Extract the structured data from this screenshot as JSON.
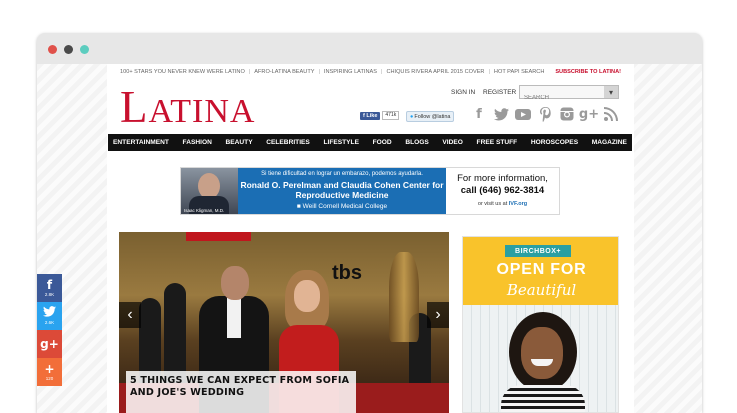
{
  "topbar": {
    "links": [
      "100+ STARS YOU NEVER KNEW WERE LATINO",
      "AFRO-LATINA BEAUTY",
      "INSPIRING LATINAS",
      "CHIQUIS RIVERA APRIL 2015 COVER",
      "HOT PAPI SEARCH"
    ],
    "subscribe": "SUBSCRIBE TO LATINA!"
  },
  "header": {
    "logo_first": "L",
    "logo_rest": "ATINA",
    "signin": "SIGN IN",
    "register": "REGISTER",
    "search_placeholder": "SEARCH",
    "fb_like": "Like",
    "fb_count": "471k",
    "tw_follow": "Follow @latina"
  },
  "social_icons": [
    "facebook-icon",
    "twitter-icon",
    "youtube-icon",
    "pinterest-icon",
    "instagram-icon",
    "google-plus-icon",
    "rss-icon"
  ],
  "nav": [
    "ENTERTAINMENT",
    "FASHION",
    "BEAUTY",
    "CELEBRITIES",
    "LIFESTYLE",
    "FOOD",
    "BLOGS",
    "VIDEO",
    "FREE STUFF",
    "HOROSCOPES",
    "MAGAZINE"
  ],
  "banner": {
    "photo_caption": "Isaac Kligman, M.D.",
    "spanish": "Si tiene dificultad en lograr un embarazo, podemos ayudarla.",
    "center": "Ronald O. Perelman and Claudia Cohen Center for Reproductive Medicine",
    "college": "Weill Cornell Medical College",
    "more_info": "For more information,",
    "phone": "call (646) 962-3814",
    "visit_prefix": "or visit us at",
    "visit_site": "IVF.org"
  },
  "hero": {
    "backdrop_logo": "tbs",
    "caption": "5 THINGS WE CAN EXPECT FROM SOFIA AND JOE'S WEDDING",
    "prev": "‹",
    "next": "›"
  },
  "ad": {
    "brand": "BIRCHBOX+",
    "headline": "OPEN FOR",
    "script": "Beautiful"
  },
  "share": [
    {
      "icon": "f",
      "count": "2.8K"
    },
    {
      "icon": "t",
      "count": "2.6K"
    },
    {
      "icon": "g+",
      "count": ""
    },
    {
      "icon": "+",
      "count": "120"
    }
  ],
  "colors": {
    "brand_red": "#c8102e",
    "nav_bg": "#111111",
    "facebook": "#3b5998",
    "twitter": "#2aa3ef",
    "google": "#dc4a38",
    "share_more": "#f26e39",
    "ad_yellow": "#f9c32b",
    "birchbox_teal": "#2a9fa2"
  }
}
